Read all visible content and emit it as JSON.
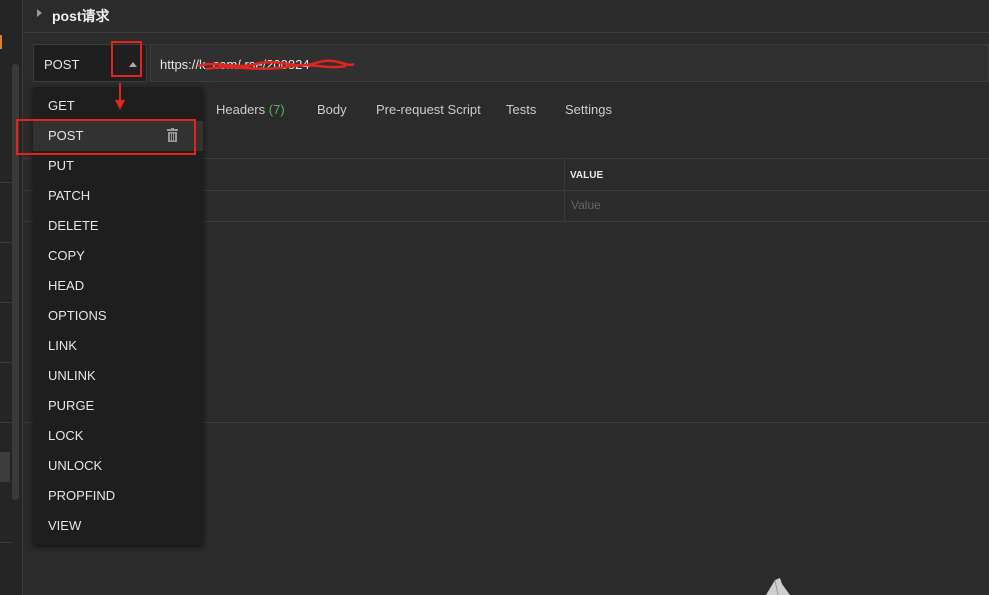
{
  "request": {
    "name": "post请求"
  },
  "method_select": {
    "value": "POST",
    "options": [
      "GET",
      "POST",
      "PUT",
      "PATCH",
      "DELETE",
      "COPY",
      "HEAD",
      "OPTIONS",
      "LINK",
      "UNLINK",
      "PURGE",
      "LOCK",
      "UNLOCK",
      "PROPFIND",
      "VIEW"
    ],
    "selected_index": 1
  },
  "url": {
    "value": "https://k          .com/          rse/200824"
  },
  "tabs": [
    {
      "label": "Headers",
      "count": "(7)"
    },
    {
      "label": "Body"
    },
    {
      "label": "Pre-request Script"
    },
    {
      "label": "Tests"
    },
    {
      "label": "Settings"
    }
  ],
  "params_table": {
    "value_header": "VALUE",
    "value_placeholder": "Value"
  },
  "icons": {
    "trash": "trash-icon",
    "dropdown_arrow": "triangle-up-icon",
    "collapse": "caret-right-icon"
  },
  "colors": {
    "annotation": "#e0241e",
    "count_green": "#59b159",
    "accent_orange": "#d9822b"
  }
}
